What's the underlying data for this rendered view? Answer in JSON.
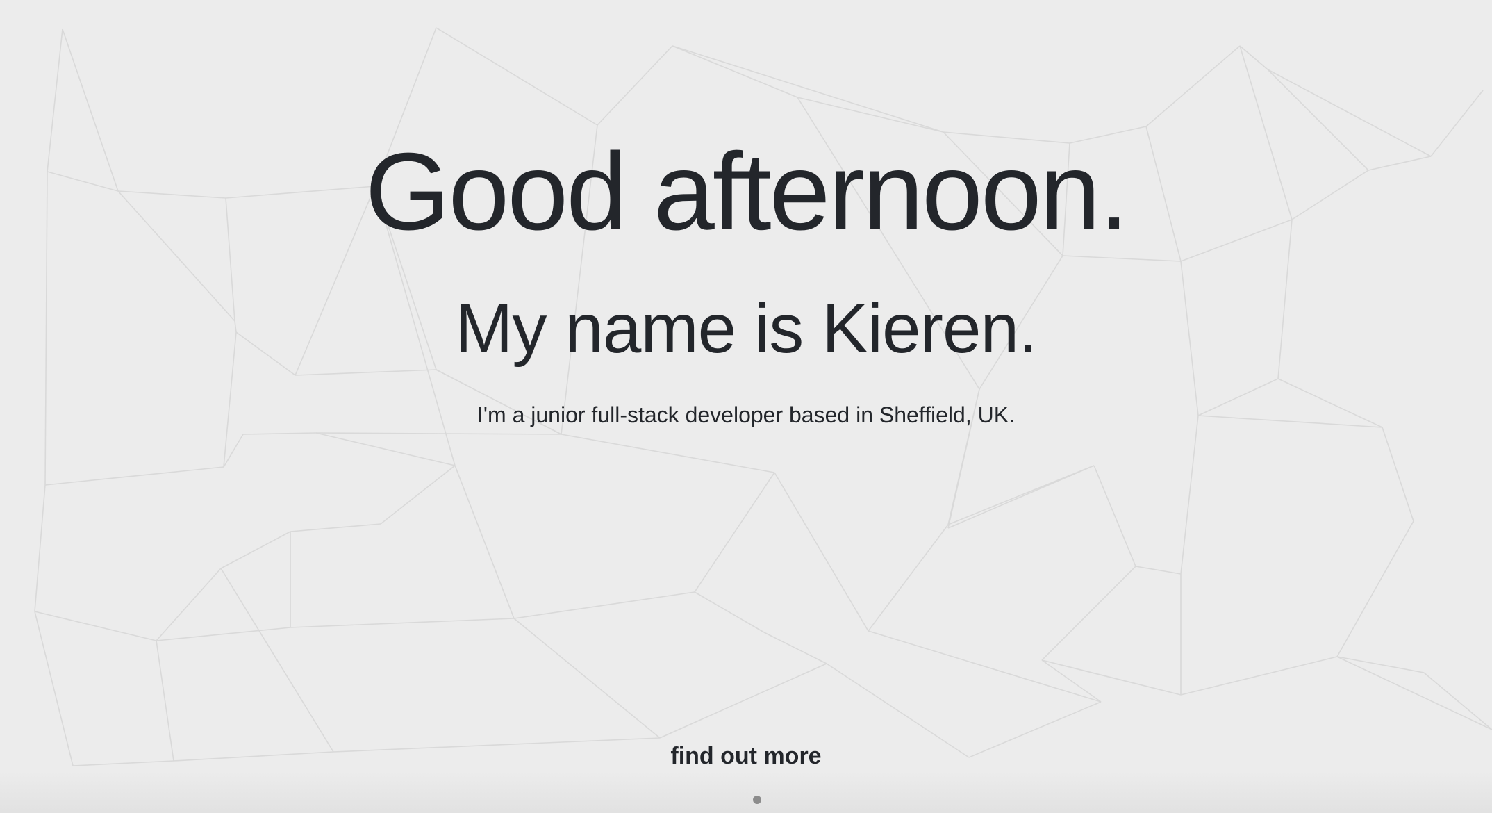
{
  "hero": {
    "greeting": "Good afternoon.",
    "name": "My name is Kieren.",
    "tagline": "I'm a junior full-stack developer based in Sheffield, UK.",
    "cta_label": "find out more"
  },
  "theme": {
    "background": "#ececec",
    "text": "#23262b",
    "mesh_line": "#d9d9d9",
    "indicator": "#8c8c8c"
  }
}
